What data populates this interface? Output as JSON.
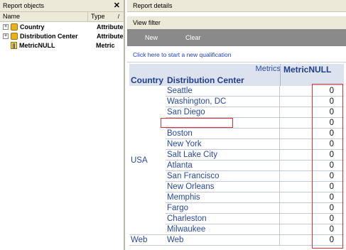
{
  "left_pane": {
    "title": "Report objects",
    "close_glyph": "✕",
    "columns": {
      "name": "Name",
      "type": "Type",
      "sort_glyph": "/"
    },
    "objects": [
      {
        "name": "Country",
        "type": "Attribute",
        "icon": "attribute-icon",
        "expandable": true
      },
      {
        "name": "Distribution Center",
        "type": "Attribute",
        "icon": "attribute-icon",
        "expandable": true
      },
      {
        "name": "MetricNULL",
        "type": "Metric",
        "icon": "metric-icon",
        "expandable": false
      }
    ]
  },
  "right_pane": {
    "title": "Report details",
    "view_filter": {
      "title": "View filter",
      "new_label": "New",
      "clear_label": "Clear",
      "qualification_link": "Click here to start a new qualification"
    },
    "grid": {
      "metrics_label": "Metrics",
      "metric_header": "MetricNULL",
      "country_header": "Country",
      "dc_header": "Distribution Center",
      "countries": [
        {
          "name": "USA",
          "rows": 14
        },
        {
          "name": "Web",
          "rows": 1
        }
      ],
      "rows": [
        {
          "dc": "Seattle",
          "value": "0"
        },
        {
          "dc": "Washington, DC",
          "value": "0"
        },
        {
          "dc": "San Diego",
          "value": "0"
        },
        {
          "dc": "",
          "value": "0"
        },
        {
          "dc": "Boston",
          "value": "0"
        },
        {
          "dc": "New York",
          "value": "0"
        },
        {
          "dc": "Salt Lake City",
          "value": "0"
        },
        {
          "dc": "Atlanta",
          "value": "0"
        },
        {
          "dc": "San Francisco",
          "value": "0"
        },
        {
          "dc": "New Orleans",
          "value": "0"
        },
        {
          "dc": "Memphis",
          "value": "0"
        },
        {
          "dc": "Fargo",
          "value": "0"
        },
        {
          "dc": "Charleston",
          "value": "0"
        },
        {
          "dc": "Milwaukee",
          "value": "0"
        },
        {
          "dc": "Web",
          "value": "0"
        }
      ]
    }
  },
  "colors": {
    "accent_text": "#2a4aa0",
    "header_bg": "#dde3ee",
    "toolbar_bg": "#8a8a8a",
    "annotation": "#e23030"
  }
}
